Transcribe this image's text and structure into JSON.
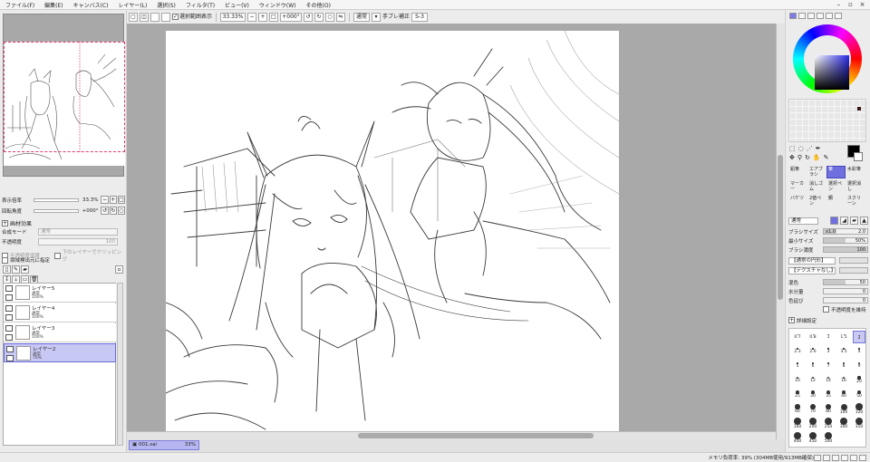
{
  "menu": [
    "ファイル(F)",
    "編集(E)",
    "キャンバス(C)",
    "レイヤー(L)",
    "選択(S)",
    "フィルタ(T)",
    "ビュー(V)",
    "ウィンドウ(W)",
    "その他(O)"
  ],
  "toolbar": {
    "selection_label": "選択範囲表示",
    "zoom": "33.33%",
    "rotation": "+000°",
    "mode": "通常",
    "stabilizer_label": "手ブレ補正",
    "stabilizer": "S-3"
  },
  "navigator": {
    "zoom_label": "表示倍率",
    "zoom_value": "33.3%",
    "rotate_label": "回転角度",
    "rotate_value": "+000°"
  },
  "layer_panel": {
    "effects_label": "画材効果",
    "blend_label": "合成モード",
    "blend_value": "通常",
    "opacity_label": "不透明度",
    "opacity_value": "100",
    "protect_label": "不透明度保護",
    "clip_label": "下のレイヤーでクリッピング",
    "source_label": "領域検出元に指定",
    "layers": [
      {
        "name": "レイヤー5",
        "mode": "通常",
        "opacity": "100%"
      },
      {
        "name": "レイヤー4",
        "mode": "通常",
        "opacity": "100%"
      },
      {
        "name": "レイヤー3",
        "mode": "通常",
        "opacity": "100%"
      },
      {
        "name": "レイヤー2",
        "mode": "通常",
        "opacity": "76%"
      }
    ]
  },
  "document_tab": {
    "name": "001.sai",
    "zoom": "33%"
  },
  "status": "メモリ負荷率: 39% (304MB使用/913MB確保)",
  "brush_tools": [
    {
      "label": "鉛筆"
    },
    {
      "label": "エアブラシ"
    },
    {
      "label": "筆"
    },
    {
      "label": "水彩筆"
    },
    {
      "label": "マーカー"
    },
    {
      "label": "消しゴム"
    },
    {
      "label": "選択ペン"
    },
    {
      "label": "選択消し"
    },
    {
      "label": "バケツ"
    },
    {
      "label": "2値ペン"
    },
    {
      "label": "鋼"
    },
    {
      "label": "スクリーン"
    }
  ],
  "brush_props": {
    "shape_mode": "通常",
    "size_label": "ブラシサイズ",
    "size_mult": "x1.0",
    "size_value": "2.0",
    "min_size_label": "最小サイズ",
    "min_size_value": "50%",
    "density_label": "ブラシ濃度",
    "density_value": "100",
    "edge_label": "【通常の円形】",
    "texture_label": "【テクスチャなし】",
    "blend_label": "混色",
    "blend_value": "50",
    "water_label": "水分量",
    "water_value": "0",
    "stretch_label": "色延び",
    "stretch_value": "0",
    "keep_opacity_label": "不透明度を維持",
    "detail_label": "詳細設定"
  },
  "brush_sizes": [
    "0.7",
    "0.8",
    "1",
    "1.5",
    "2",
    "2.3",
    "2.6",
    "3",
    "3.5",
    "4",
    "5",
    "6",
    "7",
    "8",
    "9",
    "10",
    "12",
    "14",
    "16",
    "20",
    "25",
    "30",
    "35",
    "40",
    "50",
    "60",
    "70",
    "80",
    "100",
    "120",
    "160",
    "200",
    "250",
    "300",
    "350",
    "400",
    "450",
    "500"
  ],
  "colors": {
    "accent": "#6f6fe0",
    "primary": "#000000",
    "secondary": "#ffffff"
  }
}
